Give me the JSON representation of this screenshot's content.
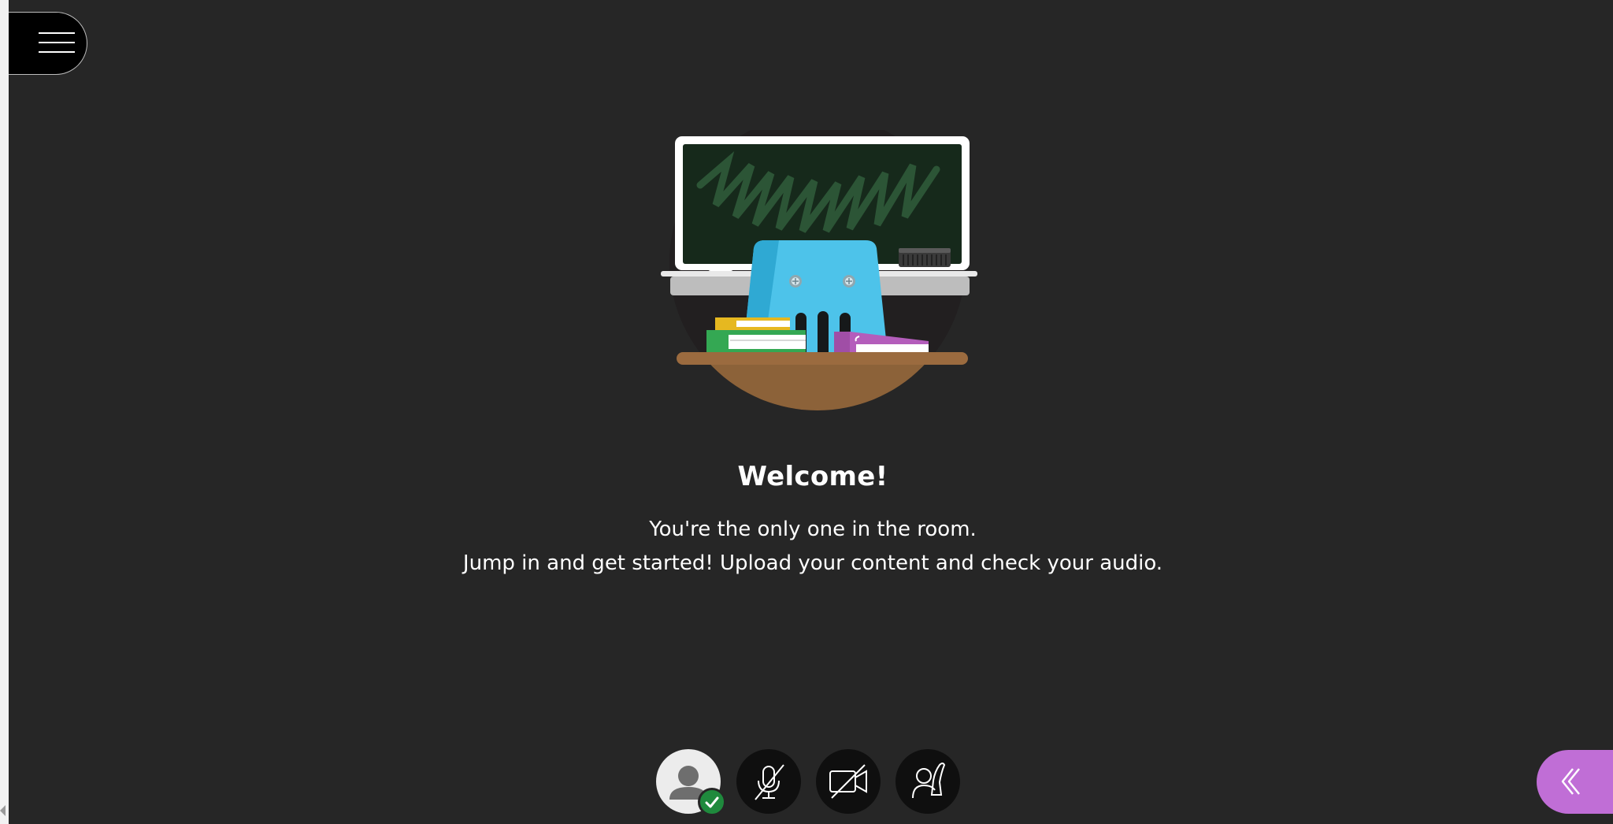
{
  "menu": {
    "icon": "hamburger-menu-icon"
  },
  "welcome": {
    "title": "Welcome!",
    "line1": "You're the only one in the room.",
    "line2": "Jump in and get started! Upload your content and check your audio."
  },
  "controls": [
    {
      "name": "my-status-and-settings",
      "icon": "avatar-icon",
      "status": "check-icon"
    },
    {
      "name": "share-audio",
      "icon": "microphone-off-icon"
    },
    {
      "name": "share-video",
      "icon": "camera-off-icon"
    },
    {
      "name": "raise-hand",
      "icon": "raise-hand-icon"
    }
  ],
  "collaborate_panel": {
    "icon": "double-chevron-left-icon"
  },
  "colors": {
    "background": "#262626",
    "control": "#0f0f0f",
    "accent_purple": "#c06ed6",
    "status_green": "#1f8a3d",
    "chalkboard": "#16291b",
    "octopus_blue": "#4dc3ea",
    "desk_brown": "#8c6239"
  }
}
